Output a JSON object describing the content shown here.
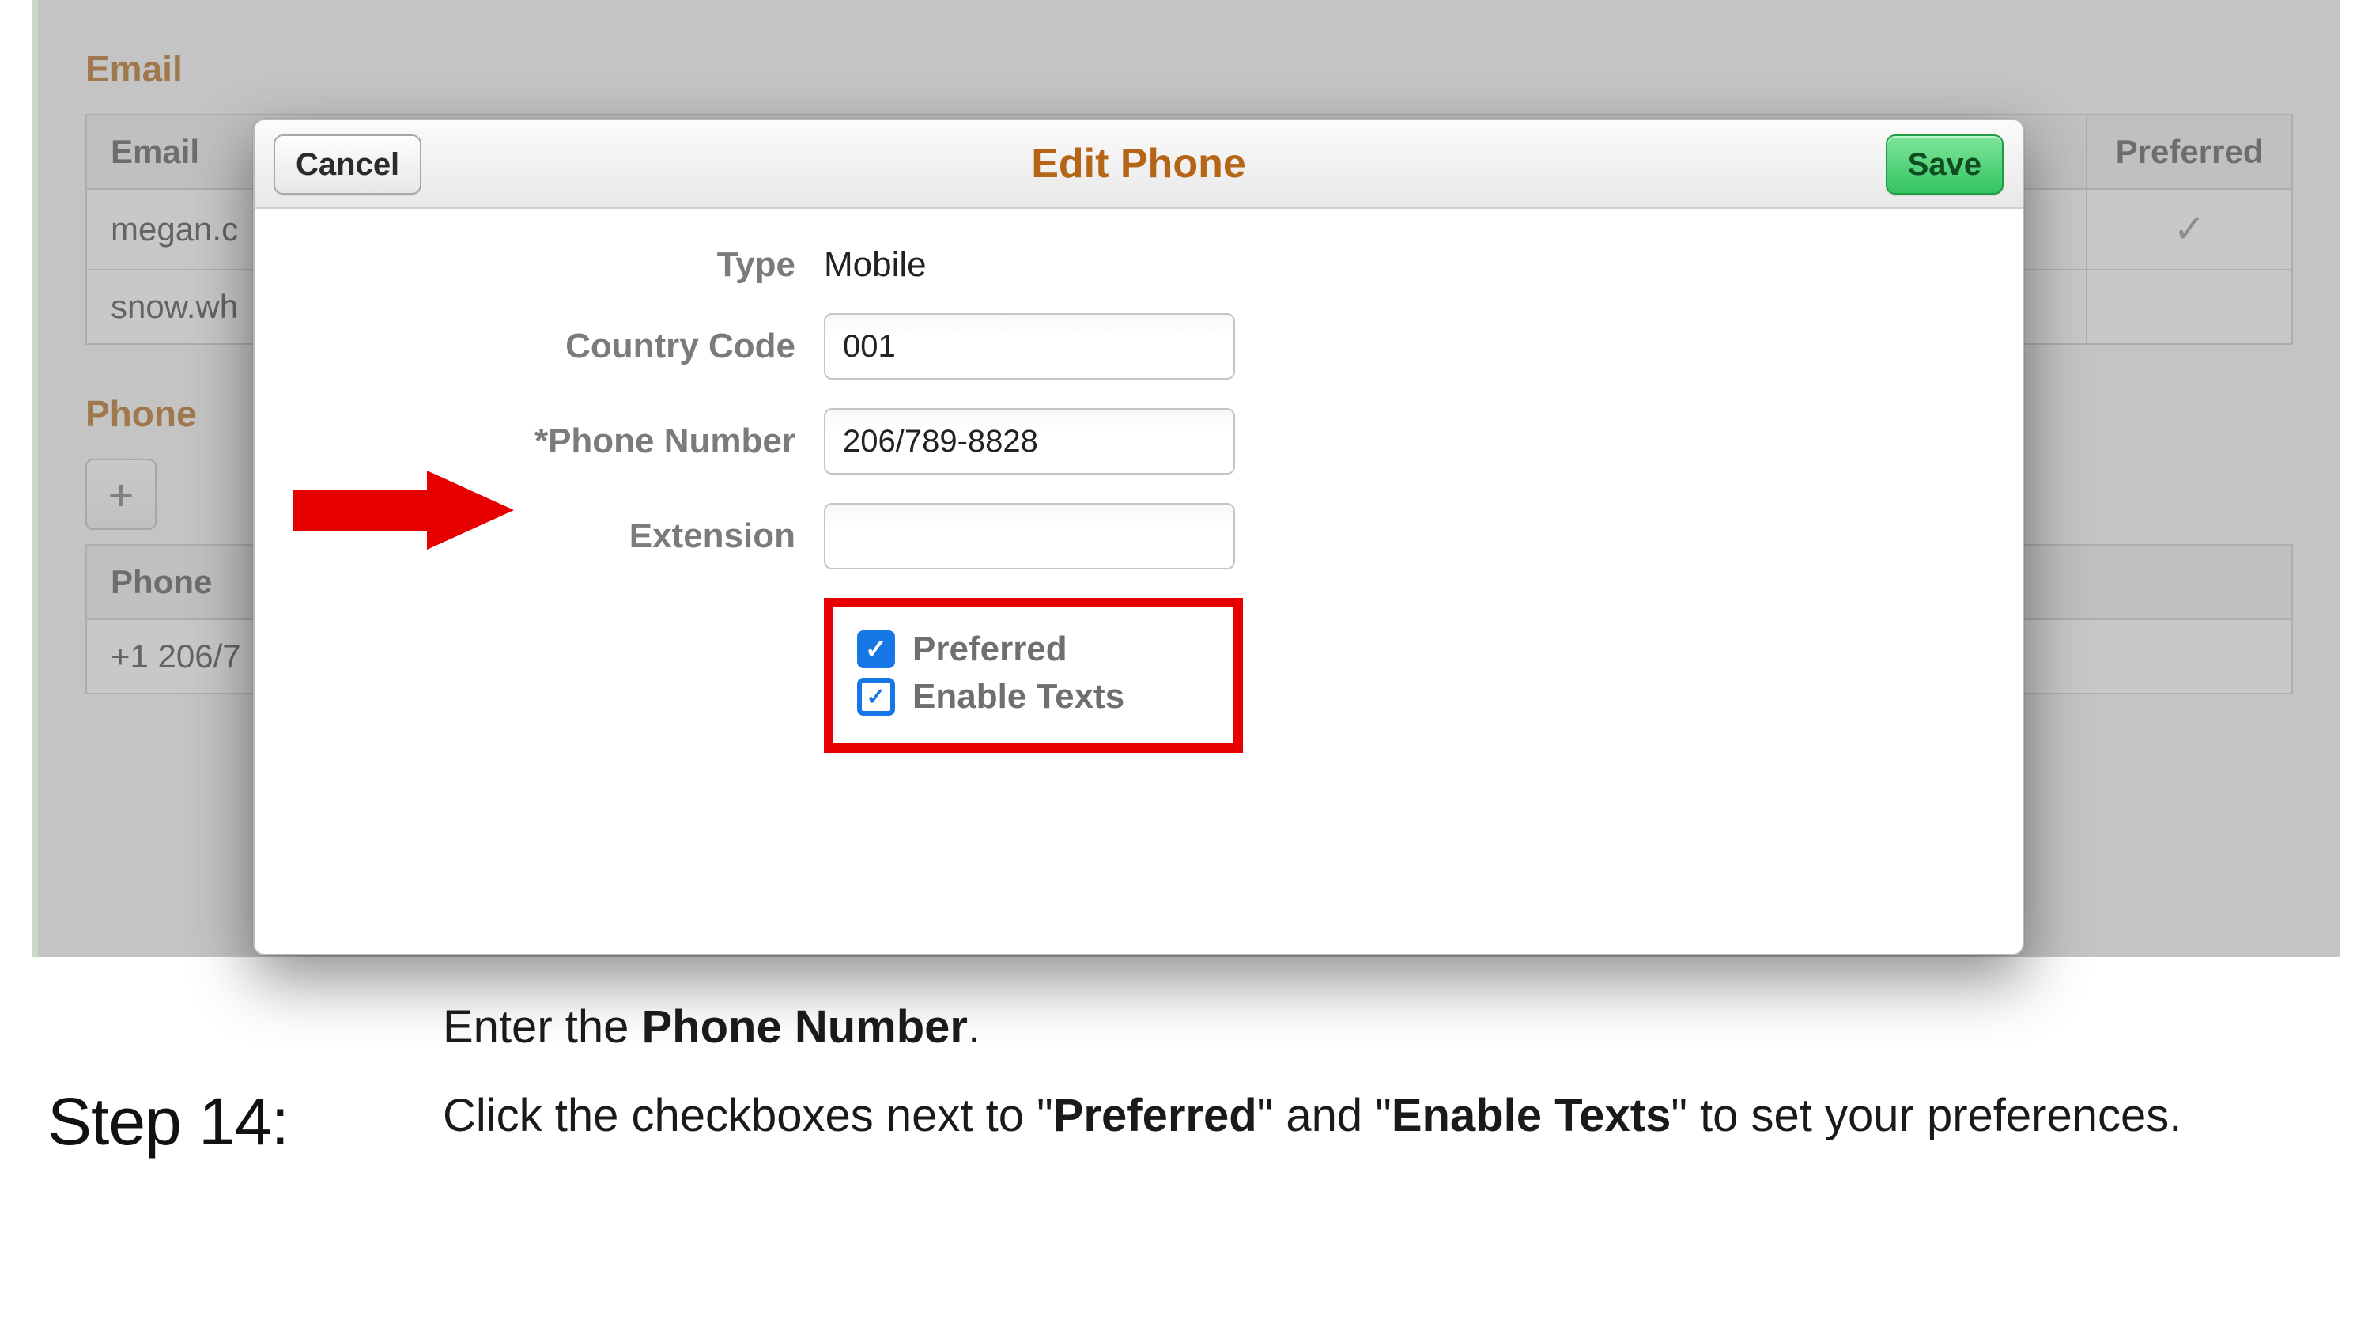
{
  "bg": {
    "email_section_title": "Email",
    "email_header": "Email",
    "preferred_header": "Preferred",
    "email_rows": [
      "megan.c",
      "snow.wh"
    ],
    "phone_section_title": "Phone",
    "phone_header": "Phone",
    "phone_rows": [
      "+1 206/7"
    ],
    "add_glyph": "+",
    "check_glyph": "✓"
  },
  "modal": {
    "title": "Edit Phone",
    "cancel_label": "Cancel",
    "save_label": "Save",
    "fields": {
      "type_label": "Type",
      "type_value": "Mobile",
      "country_code_label": "Country Code",
      "country_code_value": "001",
      "phone_number_label": "*Phone Number",
      "phone_number_value": "206/789-8828",
      "extension_label": "Extension",
      "extension_value": ""
    },
    "checkboxes": {
      "preferred_label": "Preferred",
      "preferred_checked": true,
      "enable_texts_label": "Enable Texts",
      "enable_texts_checked": true
    }
  },
  "instructions": {
    "step_label": "Step 14:",
    "line1_a": "Enter the ",
    "line1_b": "Phone Number",
    "line1_c": ".",
    "line2_a": "Click the checkboxes next to \"",
    "line2_b": "Preferred",
    "line2_c": "\" and \"",
    "line2_d": "Enable Texts",
    "line2_e": "\" to set your preferences."
  }
}
